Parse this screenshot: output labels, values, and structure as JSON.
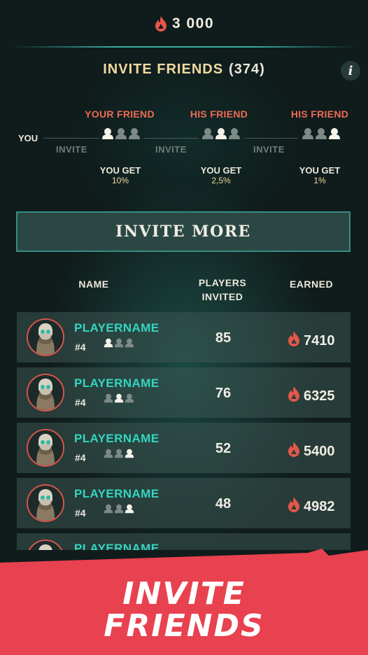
{
  "currency": {
    "icon": "flame-icon",
    "amount": "3 000",
    "color": "#e8564a"
  },
  "panel": {
    "title": "INVITE FRIENDS",
    "count": "(374)",
    "info_icon": "i"
  },
  "referral": {
    "you_label": "YOU",
    "invite_label": "INVITE",
    "tiers": [
      {
        "title": "YOUR FRIEND",
        "you_get": "YOU GET",
        "percent": "10%",
        "highlight": 0
      },
      {
        "title": "HIS FRIEND",
        "you_get": "YOU GET",
        "percent": "2,5%",
        "highlight": 1
      },
      {
        "title": "HIS FRIEND",
        "you_get": "YOU GET",
        "percent": "1%",
        "highlight": 2
      }
    ]
  },
  "invite_more_button": "INVITE MORE",
  "table": {
    "headers": {
      "name": "NAME",
      "players_invited_1": "PLAYERS",
      "players_invited_2": "INVITED",
      "earned": "EARNED"
    },
    "rows": [
      {
        "name": "PLAYERNAME",
        "rank": "#4",
        "tier_highlight": 0,
        "players_invited": "85",
        "earned": "7410"
      },
      {
        "name": "PLAYERNAME",
        "rank": "#4",
        "tier_highlight": 1,
        "players_invited": "76",
        "earned": "6325"
      },
      {
        "name": "PLAYERNAME",
        "rank": "#4",
        "tier_highlight": 2,
        "players_invited": "52",
        "earned": "5400"
      },
      {
        "name": "PLAYERNAME",
        "rank": "#4",
        "tier_highlight": 2,
        "players_invited": "48",
        "earned": "4982"
      },
      {
        "name": "PLAYERNAME"
      }
    ]
  },
  "banner": {
    "line1": "INVITE",
    "line2": "FRIENDS",
    "color": "#e8414f"
  },
  "colors": {
    "accent_teal": "#33d6c2",
    "accent_red": "#ef6a55",
    "gold": "#f1d9a0"
  }
}
